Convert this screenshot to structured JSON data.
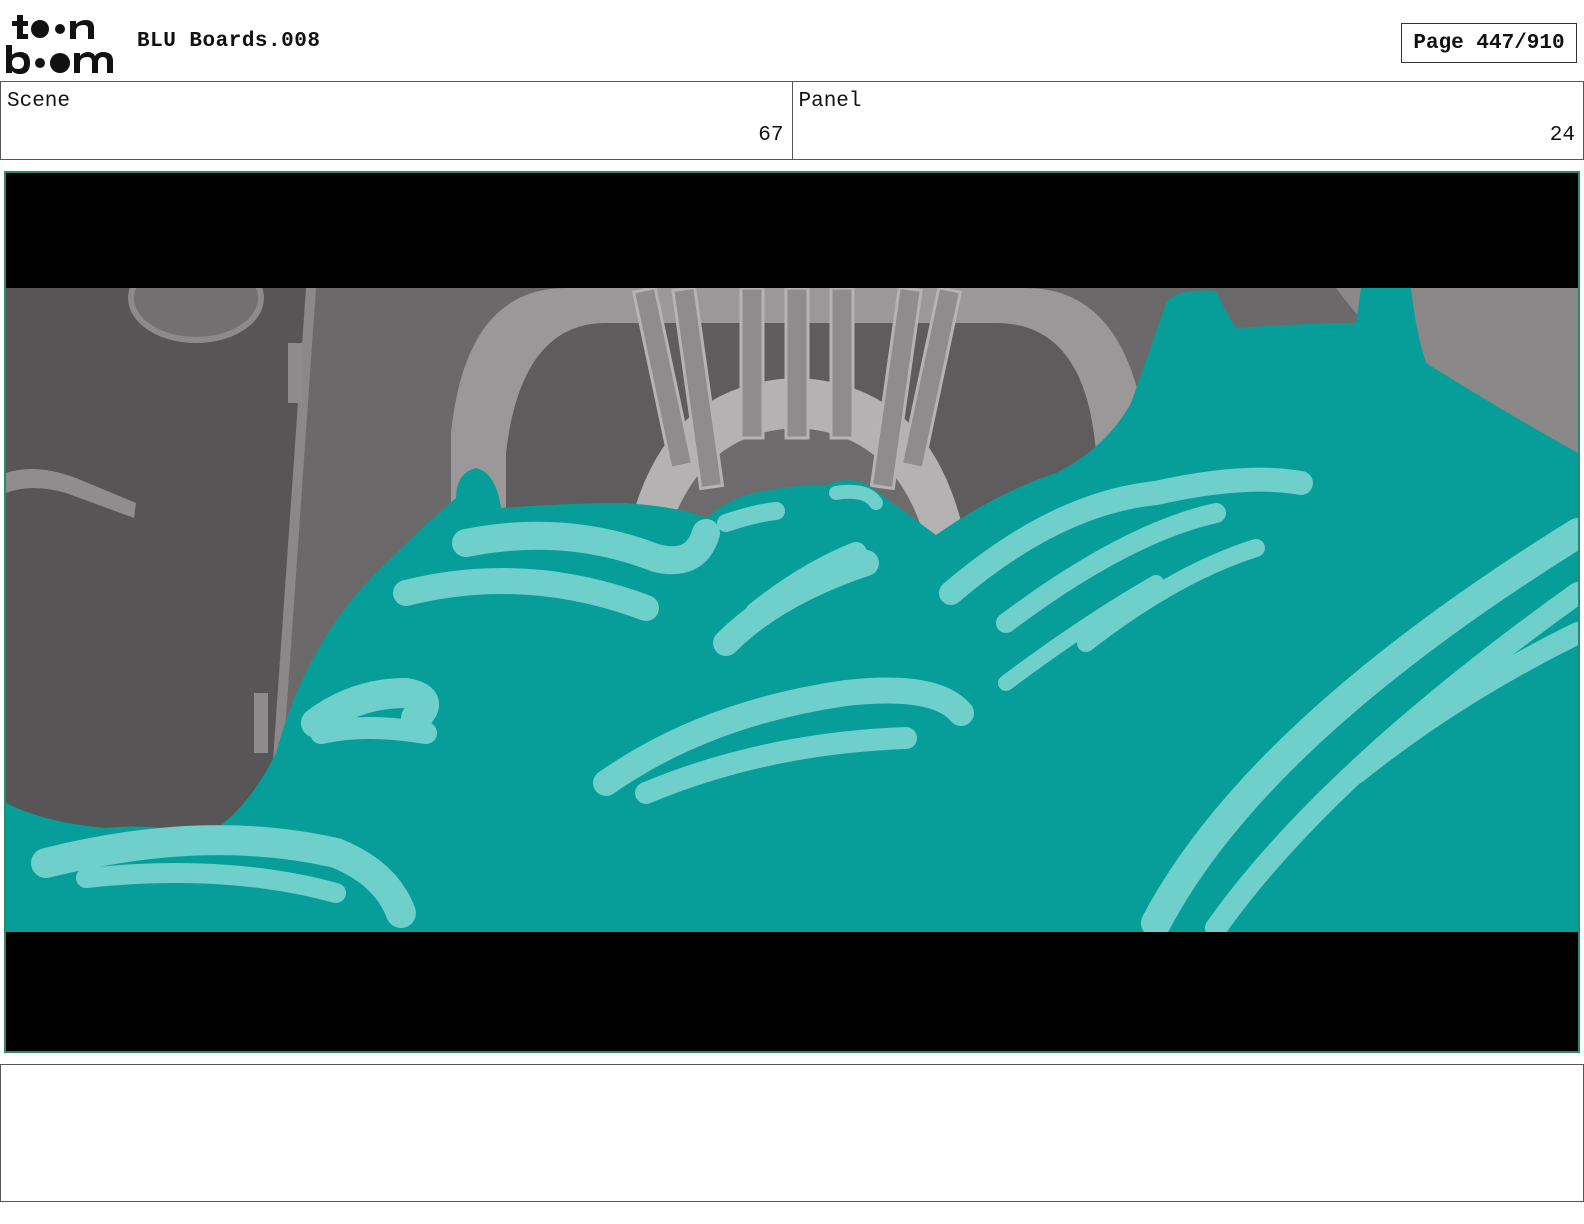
{
  "header": {
    "logo_text": "toon boom",
    "title": "BLU Boards.008",
    "page_label": "Page 447/910"
  },
  "info": {
    "scene_label": "Scene",
    "scene_value": "67",
    "panel_label": "Panel",
    "panel_value": "24"
  },
  "panel_image": {
    "letterbox_color": "#000000",
    "fill_color": "#079e99",
    "highlight_color": "#6ecfcb",
    "environment_color": "#6b6969"
  },
  "notes": {
    "text": ""
  }
}
